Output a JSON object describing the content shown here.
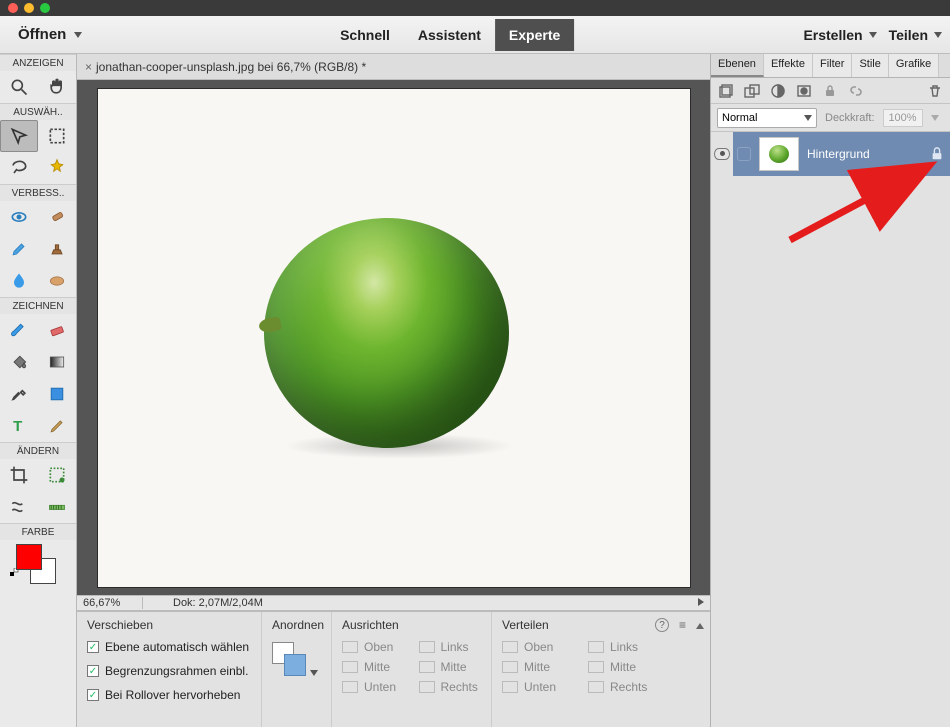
{
  "appbar": {
    "open": "Öffnen",
    "modes": [
      "Schnell",
      "Assistent",
      "Experte"
    ],
    "active_mode": "Experte",
    "create": "Erstellen",
    "share": "Teilen"
  },
  "doc_tab": {
    "title": "jonathan-cooper-unsplash.jpg bei 66,7% (RGB/8) *"
  },
  "toolbox": {
    "sections": {
      "anzeigen": "ANZEIGEN",
      "auswaehlen": "AUSWÄH..",
      "verbessern": "VERBESS..",
      "zeichnen": "ZEICHNEN",
      "aendern": "ÄNDERN",
      "farbe": "FARBE"
    },
    "colors": {
      "fg": "#ff0000",
      "bg": "#ffffff"
    }
  },
  "status": {
    "zoom": "66,67%",
    "dok": "Dok: 2,07M/2,04M"
  },
  "options": {
    "title": "Verschieben",
    "checks": {
      "auto": "Ebene automatisch wählen",
      "bounds": "Begrenzungsrahmen einbl.",
      "rollover": "Bei Rollover hervorheben"
    },
    "anordnen": "Anordnen",
    "ausrichten": "Ausrichten",
    "verteilen": "Verteilen",
    "labels": {
      "oben": "Oben",
      "links": "Links",
      "mitte": "Mitte",
      "unten": "Unten",
      "rechts": "Rechts"
    }
  },
  "panels": {
    "tabs": [
      "Ebenen",
      "Effekte",
      "Filter",
      "Stile",
      "Grafike"
    ],
    "active": "Ebenen",
    "blend_mode": "Normal",
    "opacity_label": "Deckkraft:",
    "opacity_value": "100%",
    "layer": {
      "name": "Hintergrund"
    }
  }
}
